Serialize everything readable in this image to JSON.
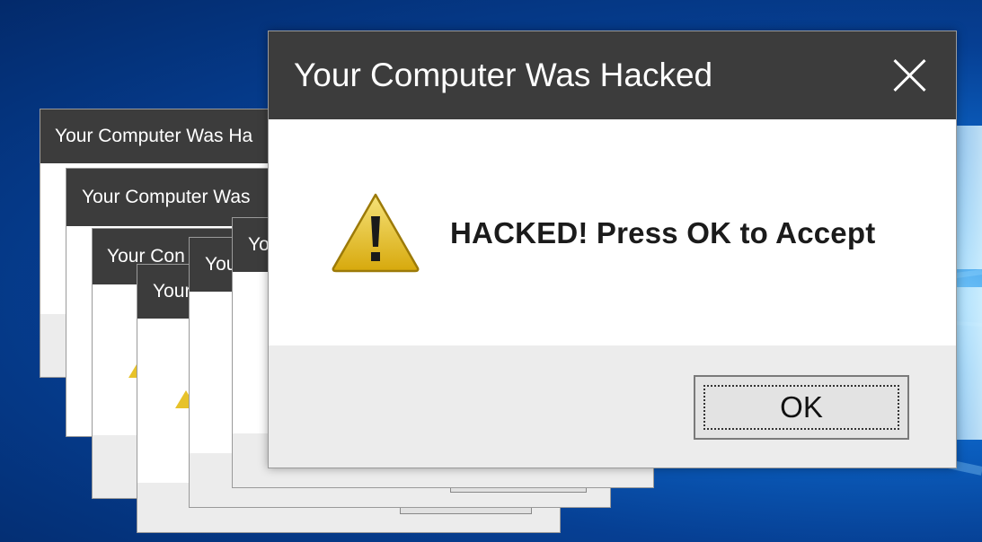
{
  "desktop": {
    "background_color": "#0b5fc0",
    "accent_color": "#7fd0ff"
  },
  "dialogs": {
    "d1": {
      "title": "Your Computer Was Ha"
    },
    "d2": {
      "title": "Your Computer Was"
    },
    "d3": {
      "title": "Your Con"
    },
    "d4": {
      "title": "Your"
    },
    "d5": {
      "title": "You"
    },
    "d6": {
      "title": "Yo"
    }
  },
  "main_dialog": {
    "title": "Your Computer Was Hacked",
    "close_icon": "close-icon",
    "warning_icon": "warning-icon",
    "message": "HACKED! Press OK to Accept",
    "ok_label": "OK",
    "titlebar_color": "#3c3c3c",
    "footer_color": "#ececec",
    "warning_color": "#e7c22a"
  }
}
